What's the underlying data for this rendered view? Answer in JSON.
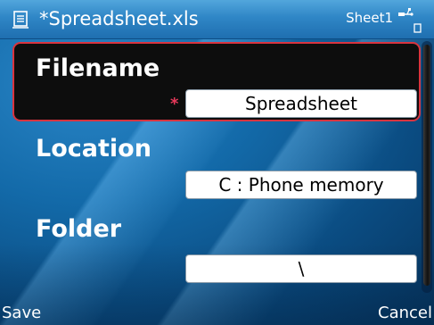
{
  "titlebar": {
    "title": "*Spreadsheet.xls",
    "sheet_indicator": "Sheet1",
    "doc_icon": "spreadsheet-doc-icon",
    "usb_icon": "usb-connection-icon",
    "battery_icon": "battery-icon"
  },
  "form": {
    "filename": {
      "label": "Filename",
      "required_marker": "*",
      "value": "Spreadsheet"
    },
    "location": {
      "label": "Location",
      "value": "C : Phone memory"
    },
    "folder": {
      "label": "Folder",
      "value": "\\"
    }
  },
  "softkeys": {
    "left": "Save",
    "right": "Cancel"
  },
  "colors": {
    "focus_border": "#d8343f",
    "required_marker": "#e6395a",
    "titlebar": "#2f86c6",
    "background": "#0b4f86"
  }
}
